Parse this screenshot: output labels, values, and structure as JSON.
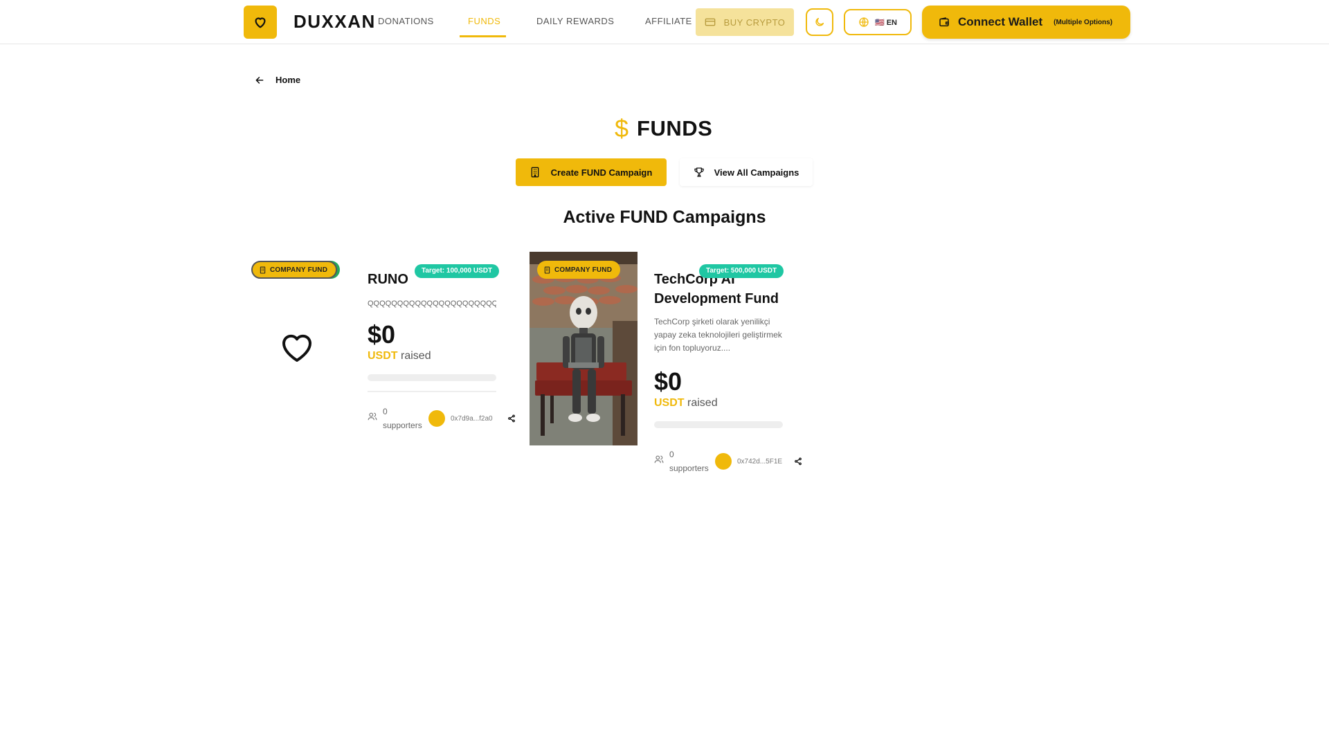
{
  "header": {
    "brand": "DUXXAN",
    "logo_icon": "heart-icon",
    "nav": {
      "donations": "DONATIONS",
      "funds": "FUNDS",
      "daily_rewards": "DAILY REWARDS",
      "affiliate": "AFFILIATE"
    },
    "active_nav": "FUNDS",
    "buy_crypto": "BUY CRYPTO",
    "language": "🇺🇸 EN",
    "connect_wallet": "Connect Wallet",
    "connect_wallet_sub": "(Multiple Options)"
  },
  "breadcrumb": {
    "back_label": "Home"
  },
  "page": {
    "title": "FUNDS",
    "title_icon": "$",
    "create_button": "Create FUND Campaign",
    "view_all_button": "View All Campaigns",
    "section_title": "Active FUND Campaigns"
  },
  "campaigns": [
    {
      "badge": "COMPANY FUND",
      "target": "Target: 100,000 USDT",
      "title": "RUNO",
      "description": "QQQQQQQQQQQQQQQQQQQQQQQQ",
      "amount": "$0",
      "currency": "USDT",
      "raised_label": "raised",
      "progress": 0,
      "supporters_count": "0",
      "supporters_label": "supporters",
      "owner": "0x7d9a...f2a0",
      "media": "heart-icon"
    },
    {
      "badge": "COMPANY FUND",
      "target": "Target: 500,000 USDT",
      "title": "TechCorp AI Development Fund",
      "description": "TechCorp şirketi olarak yenilikçi yapay zeka teknolojileri geliştirmek için fon topluyoruz....",
      "amount": "$0",
      "currency": "USDT",
      "raised_label": "raised",
      "progress": 0,
      "supporters_count": "0",
      "supporters_label": "supporters",
      "owner": "0x742d...5F1E",
      "media": "robot-photo"
    }
  ],
  "colors": {
    "accent": "#f0b90b",
    "target_badge": "#1fc7a3",
    "text": "#111111"
  }
}
